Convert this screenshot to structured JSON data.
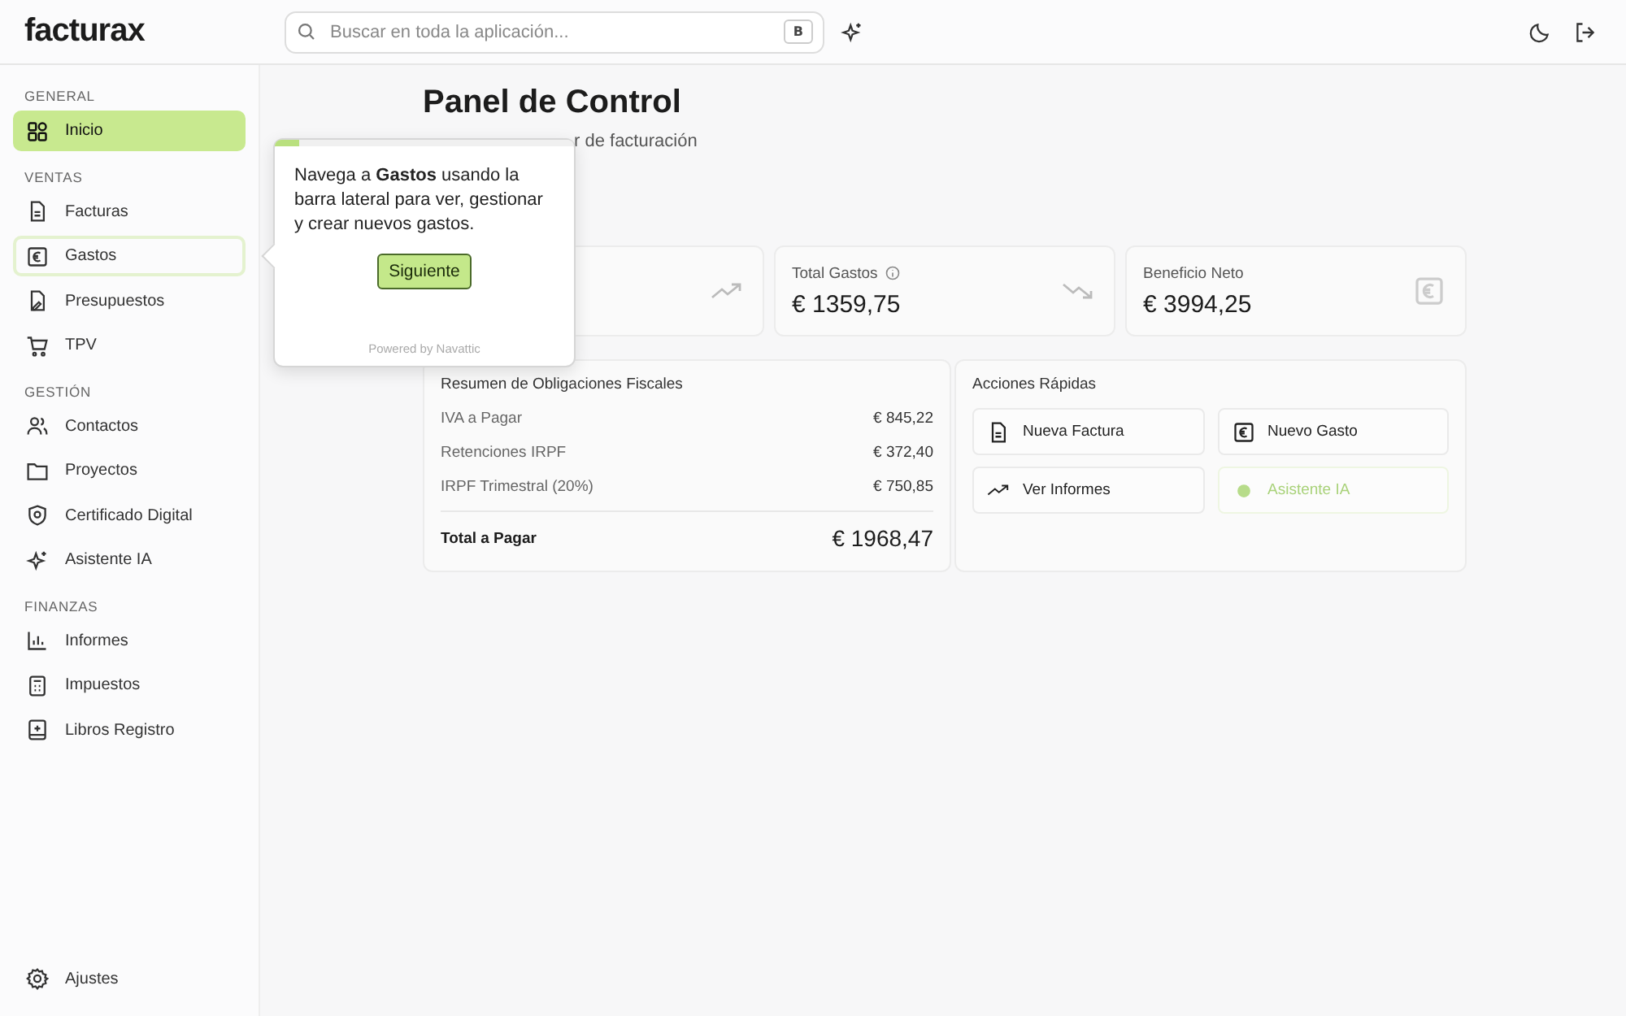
{
  "app": {
    "logo": "facturax"
  },
  "search": {
    "placeholder": "Buscar en toda la aplicación...",
    "shortcut": "B"
  },
  "sidebar": {
    "sections": [
      {
        "title": "GENERAL",
        "items": [
          {
            "label": "Inicio",
            "kind": "grid",
            "selected": true,
            "highlighted": false
          }
        ]
      },
      {
        "title": "VENTAS",
        "items": [
          {
            "label": "Facturas",
            "kind": "doc",
            "selected": false,
            "highlighted": false
          },
          {
            "label": "Gastos",
            "kind": "euro",
            "selected": false,
            "highlighted": true
          },
          {
            "label": "Presupuestos",
            "kind": "pen",
            "selected": false,
            "highlighted": false
          },
          {
            "label": "TPV",
            "kind": "cart",
            "selected": false,
            "highlighted": false
          }
        ]
      },
      {
        "title": "GESTIÓN",
        "items": [
          {
            "label": "Contactos",
            "kind": "users",
            "selected": false,
            "highlighted": false
          },
          {
            "label": "Proyectos",
            "kind": "folder",
            "selected": false,
            "highlighted": false
          },
          {
            "label": "Certificado Digital",
            "kind": "shield",
            "selected": false,
            "highlighted": false
          },
          {
            "label": "Asistente IA",
            "kind": "sparkle",
            "selected": false,
            "highlighted": false
          }
        ]
      },
      {
        "title": "FINANZAS",
        "items": [
          {
            "label": "Informes",
            "kind": "chart",
            "selected": false,
            "highlighted": false
          },
          {
            "label": "Impuestos",
            "kind": "calc",
            "selected": false,
            "highlighted": false
          },
          {
            "label": "Libros Registro",
            "kind": "book",
            "selected": false,
            "highlighted": false
          }
        ]
      }
    ],
    "footer": {
      "label": "Ajustes",
      "kind": "gear"
    }
  },
  "page": {
    "title": "Panel de Control",
    "subtitle": "r de facturación"
  },
  "stats": [
    {
      "kind": "trend-up"
    },
    {
      "label": "Total Gastos",
      "value": "€ 1359,75",
      "kind": "trend-down",
      "info": true
    },
    {
      "label": "Beneficio Neto",
      "value": "€ 3994,25",
      "kind": "euro",
      "info": false
    }
  ],
  "taxes": {
    "title": "Resumen de Obligaciones Fiscales",
    "rows": [
      {
        "label": "IVA a Pagar",
        "value": "€ 845,22"
      },
      {
        "label": "Retenciones IRPF",
        "value": "€ 372,40"
      },
      {
        "label": "IRPF Trimestral (20%)",
        "value": "€ 750,85"
      }
    ],
    "total": {
      "label": "Total a Pagar",
      "value": "€ 1968,47"
    }
  },
  "actions": {
    "title": "Acciones Rápidas",
    "items": [
      {
        "label": "Nueva Factura",
        "kind": "doc",
        "highlighted": false
      },
      {
        "label": "Nuevo Gasto",
        "kind": "euro",
        "highlighted": false
      },
      {
        "label": "Ver Informes",
        "kind": "trend-up",
        "highlighted": false
      },
      {
        "label": "Asistente IA",
        "kind": "dot",
        "highlighted": true
      }
    ]
  },
  "tour": {
    "text": "Navega a **Gastos** usando la barra lateral para ver, gestionar y crear nuevos gastos.",
    "button": "Siguiente",
    "footer": "Powered by Navattic",
    "level": 0.08
  }
}
